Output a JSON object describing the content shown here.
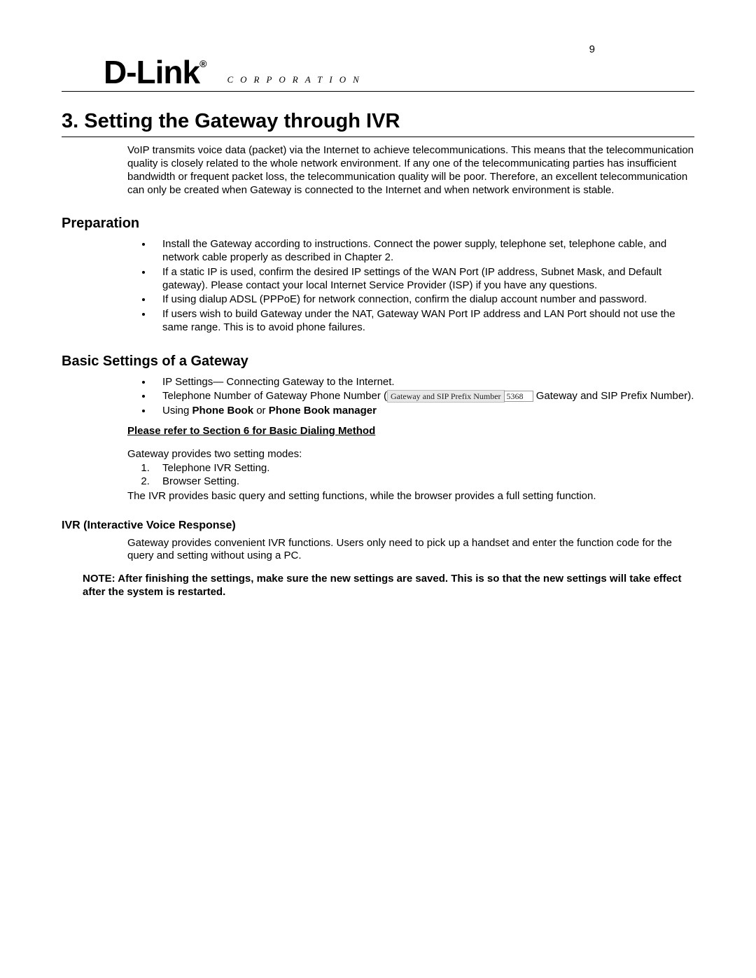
{
  "page_number": "9",
  "logo_text": "D-Link",
  "logo_trademark": "®",
  "corp_text": "CORPORATION",
  "section_title": "3.  Setting the Gateway through IVR",
  "intro_text": "VoIP transmits voice data (packet) via the Internet to achieve telecommunications. This means that the telecommunication quality is closely related to the whole network environment. If any one of the telecommunicating parties has insufficient bandwidth or frequent packet loss, the telecommunication quality will be poor.   Therefore, an excellent telecommunication can only be created when Gateway is connected to the Internet and when network environment is stable.",
  "preparation": {
    "heading": "Preparation",
    "items": [
      "Install the Gateway according to instructions. Connect the power supply, telephone set, telephone cable, and network cable properly as described in Chapter 2.",
      "If a static IP is used, confirm the desired IP settings of the WAN Port (IP address, Subnet Mask, and Default gateway). Please contact your local Internet Service Provider (ISP) if you have any questions.",
      "If using dialup ADSL (PPPoE) for network connection, confirm the dialup account number and password.",
      "If users wish to build Gateway under the NAT, Gateway WAN Port IP address and LAN Port should not use the same range. This is to avoid phone failures."
    ]
  },
  "basic": {
    "heading": "Basic Settings of a Gateway",
    "item1": "IP Settings— Connecting Gateway to the Internet.",
    "item2_prefix": "Telephone Number of Gateway Phone Number (",
    "item2_label": "Gateway and SIP Prefix Number",
    "item2_input": "5368",
    "item2_suffix": "Gateway and SIP Prefix Number).",
    "item3_prefix": "Using ",
    "item3_bold1": "Phone Book",
    "item3_mid": " or ",
    "item3_bold2": "Phone Book manager",
    "refline": "Please refer to Section 6 for Basic Dialing Method",
    "modes_intro": "Gateway provides two setting modes:",
    "modes": [
      "Telephone IVR Setting.",
      "Browser Setting."
    ],
    "modes_outro": "The IVR provides basic query and setting functions, while the browser provides a full setting function."
  },
  "ivr": {
    "heading": "IVR (Interactive Voice Response)",
    "text": "Gateway provides convenient IVR functions. Users only need to pick up a handset and enter the function code for the query and setting without using a PC."
  },
  "note": "NOTE: After finishing the settings, make sure the new settings are saved. This is so that the new settings will take effect after the system is restarted."
}
